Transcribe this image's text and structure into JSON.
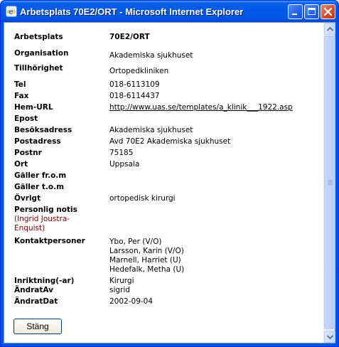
{
  "window": {
    "title": "Arbetsplats 70E2/ORT - Microsoft Internet Explorer",
    "icon": "ie-icon"
  },
  "rows": [
    {
      "label": "Arbetsplats",
      "value": "70E2/ORT"
    },
    {
      "label": "Organisation",
      "value": "Akademiska sjukhuset"
    },
    {
      "label": "Tillhörighet",
      "value": "Ortopedkliniken"
    },
    {
      "label": "Tel",
      "value": "018-6113109"
    },
    {
      "label": "Fax",
      "value": "018-6114437"
    },
    {
      "label": "Hem-URL",
      "value": "http://www.uas.se/templates/a_klinik___1922.asp"
    },
    {
      "label": "Epost",
      "value": ""
    },
    {
      "label": "Besöksadress",
      "value": "Akademiska sjukhuset"
    },
    {
      "label": "Postadress",
      "value": "Avd 70E2 Akademiska sjukhuset"
    },
    {
      "label": "Postnr",
      "value": "75185"
    },
    {
      "label": "Ort",
      "value": "Uppsala"
    },
    {
      "label": "Gäller fr.o.m",
      "value": ""
    },
    {
      "label": "Gäller t.o.m",
      "value": ""
    },
    {
      "label": "Övrigt",
      "value": "ortopedisk kirurgi"
    },
    {
      "label": "Personlig notis",
      "sublabel": "(Ingrid Joustra-Enquist)",
      "value": ""
    },
    {
      "label": "Kontaktpersoner",
      "contacts": [
        "Ybo, Per (V/O)",
        "Larsson, Karin (V/O)",
        "Marnell, Harriet (U)",
        "Hedefalk, Metha (U)"
      ]
    },
    {
      "label": "Inriktning(-ar)",
      "value": "Kirurgi"
    },
    {
      "label": "ÄndratAv",
      "value": "sigrid"
    },
    {
      "label": "ÄndratDat",
      "value": "2002-09-04"
    }
  ],
  "buttons": {
    "close_label": "Stäng"
  },
  "colors": {
    "title_bar": "#0054e3",
    "highlight_value": "#800000",
    "link": "#0000ee",
    "meta_value": "#000080"
  }
}
